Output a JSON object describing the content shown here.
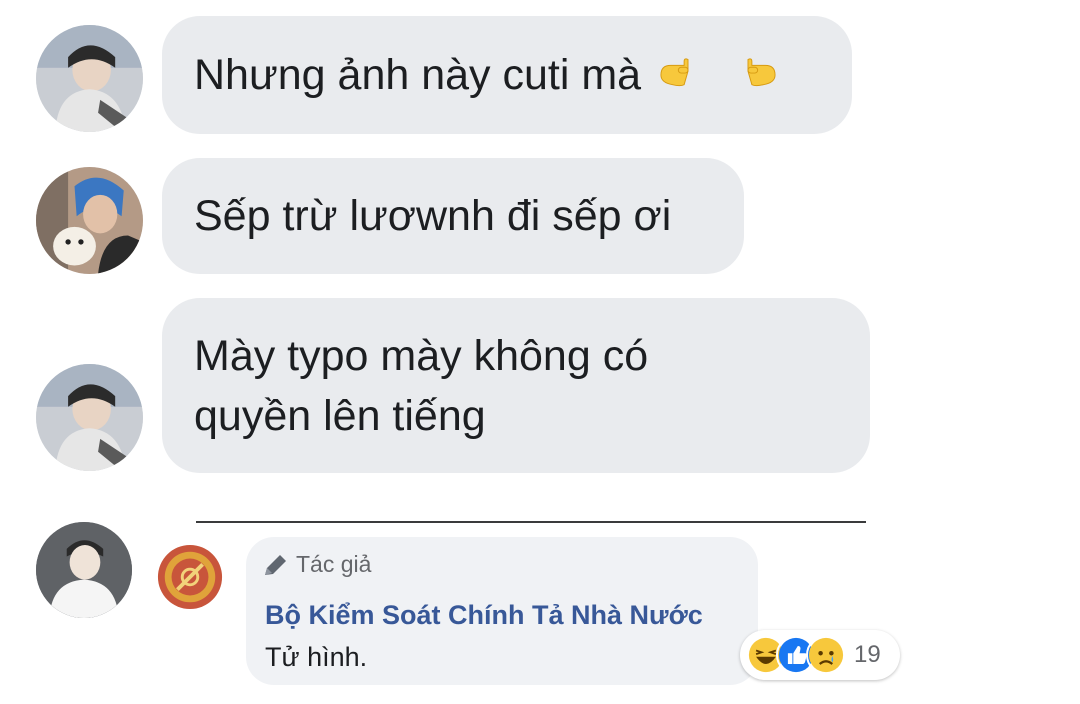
{
  "messages": [
    {
      "text": "Nhưng ảnh này cuti mà",
      "emoji": "pointing-hands-icon"
    },
    {
      "text": "Sếp trừ lươwnh đi sếp ơi"
    },
    {
      "text": "Mày typo mày không có\nquyền lên tiếng"
    }
  ],
  "quoted_comment": {
    "author_tag": "Tác giả",
    "name": "Bộ Kiểm Soát Chính Tả Nhà Nước",
    "text": " Tử hình.",
    "reaction_count": "19",
    "reactions": [
      "haha-icon",
      "like-icon",
      "sad-icon"
    ]
  },
  "colors": {
    "bubble": "#e9ebee",
    "link": "#385898",
    "text": "#1c1e21",
    "muted": "#65676b"
  }
}
